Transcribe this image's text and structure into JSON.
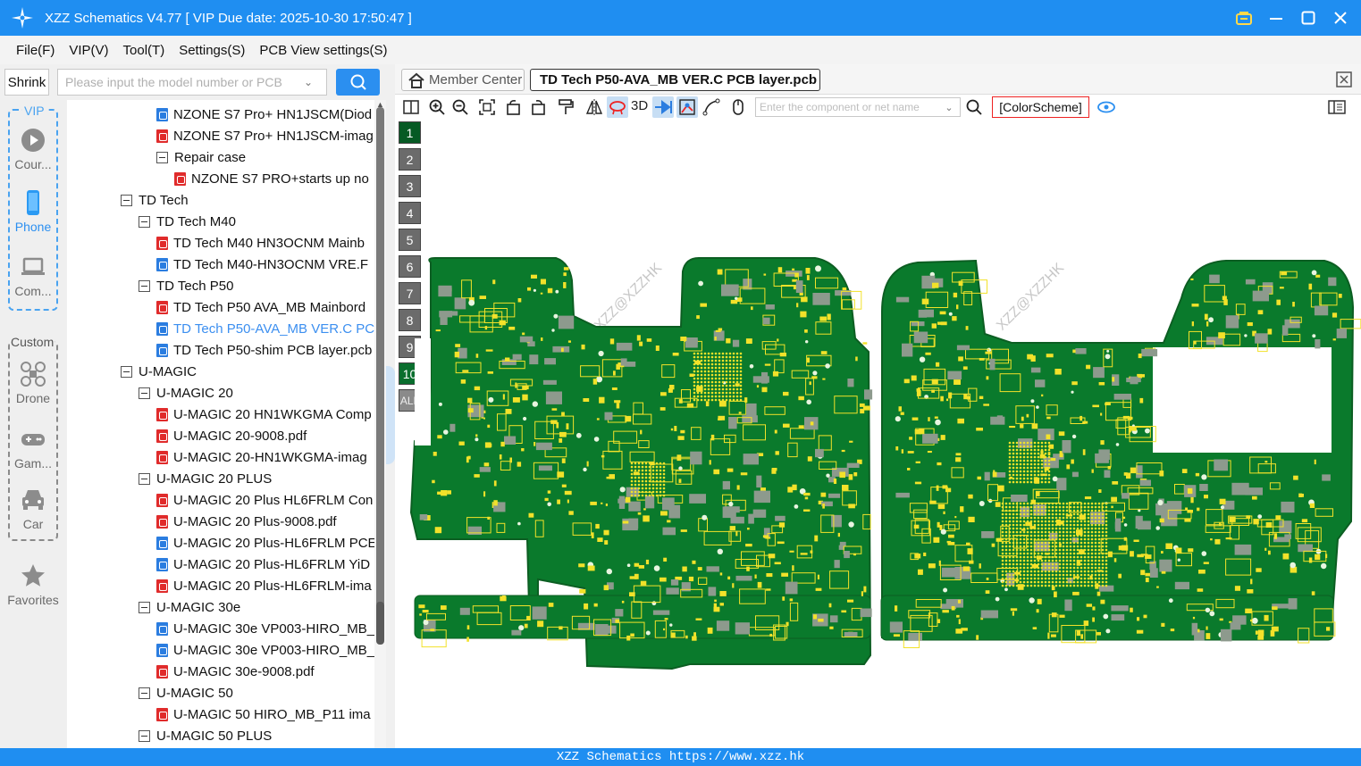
{
  "window": {
    "title": "XZZ Schematics V4.77 [ VIP Due date: 2025-10-30 17:50:47 ]"
  },
  "menu": [
    "File(F)",
    "VIP(V)",
    "Tool(T)",
    "Settings(S)",
    "PCB View settings(S)"
  ],
  "left_search": {
    "shrink_label": "Shrink",
    "placeholder": "Please input the model number or PCB"
  },
  "categories": {
    "vip_label": "VIP",
    "custom_label": "Custom",
    "items": [
      {
        "label": "Cour...",
        "icon": "play-icon"
      },
      {
        "label": "Phone",
        "icon": "phone-icon",
        "active": true
      },
      {
        "label": "Com...",
        "icon": "laptop-icon"
      },
      {
        "label": "Drone",
        "icon": "drone-icon"
      },
      {
        "label": "Gam...",
        "icon": "gamepad-icon"
      },
      {
        "label": "Car",
        "icon": "car-icon"
      },
      {
        "label": "Favorites",
        "icon": "star-icon"
      }
    ]
  },
  "tree": [
    {
      "label": "NZONE S7 Pro+ HN1JSCM(Diod",
      "kind": "pcb",
      "level": 3
    },
    {
      "label": "NZONE S7 Pro+ HN1JSCM-imag",
      "kind": "pdf",
      "level": 3
    },
    {
      "label": "Repair case",
      "kind": "folder",
      "level": 3
    },
    {
      "label": "NZONE S7 PRO+starts up no",
      "kind": "pdf",
      "level": 4
    },
    {
      "label": "TD Tech",
      "kind": "folder",
      "level": 1
    },
    {
      "label": "TD Tech M40",
      "kind": "folder",
      "level": 2
    },
    {
      "label": "TD Tech M40 HN3OCNM Mainb",
      "kind": "pdf",
      "level": 3
    },
    {
      "label": "TD Tech M40-HN3OCNM VRE.F",
      "kind": "pcb",
      "level": 3
    },
    {
      "label": "TD Tech P50",
      "kind": "folder",
      "level": 2
    },
    {
      "label": "TD Tech P50 AVA_MB Mainbord",
      "kind": "pdf",
      "level": 3
    },
    {
      "label": "TD Tech P50-AVA_MB VER.C PC",
      "kind": "pcb",
      "level": 3,
      "selected": true
    },
    {
      "label": "TD Tech P50-shim PCB layer.pcb",
      "kind": "pcb",
      "level": 3
    },
    {
      "label": "U-MAGIC",
      "kind": "folder",
      "level": 1
    },
    {
      "label": "U-MAGIC 20",
      "kind": "folder",
      "level": 2
    },
    {
      "label": "U-MAGIC 20 HN1WKGMA Comp",
      "kind": "pdf",
      "level": 3
    },
    {
      "label": "U-MAGIC 20-9008.pdf",
      "kind": "pdf",
      "level": 3
    },
    {
      "label": "U-MAGIC 20-HN1WKGMA-imag",
      "kind": "pdf",
      "level": 3
    },
    {
      "label": "U-MAGIC 20 PLUS",
      "kind": "folder",
      "level": 2
    },
    {
      "label": "U-MAGIC 20 Plus HL6FRLM Con",
      "kind": "pdf",
      "level": 3
    },
    {
      "label": "U-MAGIC 20 Plus-9008.pdf",
      "kind": "pdf",
      "level": 3
    },
    {
      "label": "U-MAGIC 20 Plus-HL6FRLM PCE",
      "kind": "pcb",
      "level": 3
    },
    {
      "label": "U-MAGIC 20 Plus-HL6FRLM YiD",
      "kind": "pcb",
      "level": 3
    },
    {
      "label": "U-MAGIC 20 Plus-HL6FRLM-ima",
      "kind": "pdf",
      "level": 3
    },
    {
      "label": "U-MAGIC 30e",
      "kind": "folder",
      "level": 2
    },
    {
      "label": "U-MAGIC 30e VP003-HIRO_MB_",
      "kind": "pcb",
      "level": 3
    },
    {
      "label": "U-MAGIC 30e VP003-HIRO_MB_",
      "kind": "pcb",
      "level": 3
    },
    {
      "label": "U-MAGIC 30e-9008.pdf",
      "kind": "pdf",
      "level": 3
    },
    {
      "label": "U-MAGIC 50",
      "kind": "folder",
      "level": 2
    },
    {
      "label": "U-MAGIC 50 HIRO_MB_P11 ima",
      "kind": "pdf",
      "level": 3
    },
    {
      "label": "U-MAGIC 50 PLUS",
      "kind": "folder",
      "level": 2
    }
  ],
  "tabs": {
    "member_center": "Member Center",
    "active_file": "TD Tech P50-AVA_MB VER.C PCB layer.pcb"
  },
  "toolbar": {
    "label_3d": "3D",
    "component_placeholder": "Enter the component or net name",
    "color_scheme": "[ColorScheme]"
  },
  "layers": [
    "1",
    "2",
    "3",
    "4",
    "5",
    "6",
    "7",
    "8",
    "9",
    "10",
    "ALL"
  ],
  "watermark": "XZZ@XZZHK",
  "status": "XZZ Schematics https://www.xzz.hk",
  "colors": {
    "accent": "#1f8ef1",
    "pcb_green": "#0a7a2c",
    "pad_yellow": "#f2e22a",
    "selected_text": "#3c8ff0"
  }
}
